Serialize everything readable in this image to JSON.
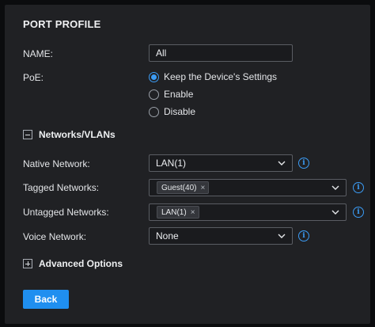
{
  "page": {
    "title": "PORT PROFILE"
  },
  "name": {
    "label": "NAME:",
    "value": "All"
  },
  "poe": {
    "label": "PoE:",
    "options": [
      {
        "label": "Keep the Device's Settings",
        "selected": true
      },
      {
        "label": "Enable",
        "selected": false
      },
      {
        "label": "Disable",
        "selected": false
      }
    ]
  },
  "networks_section": {
    "label": "Networks/VLANs",
    "expanded": true
  },
  "native_network": {
    "label": "Native Network:",
    "value": "LAN(1)"
  },
  "tagged_networks": {
    "label": "Tagged Networks:",
    "chips": [
      "Guest(40)"
    ]
  },
  "untagged_networks": {
    "label": "Untagged Networks:",
    "chips": [
      "LAN(1)"
    ]
  },
  "voice_network": {
    "label": "Voice Network:",
    "value": "None"
  },
  "advanced_section": {
    "label": "Advanced Options",
    "expanded": false
  },
  "back_button": {
    "label": "Back"
  },
  "icons": {
    "info": "i",
    "remove": "×"
  },
  "colors": {
    "accent": "#1f8ff0",
    "panel": "#202124",
    "background": "#0b0c0e"
  }
}
